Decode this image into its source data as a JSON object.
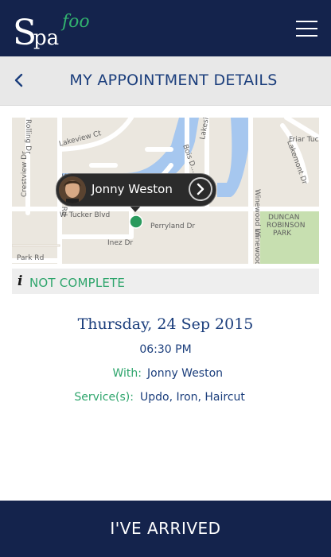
{
  "app": {
    "logo_text": "Spafoo",
    "colors": {
      "nav_bg": "#14234c",
      "title_blue": "#1b3e7c",
      "accent_green": "#2ea56c",
      "title_bar_bg": "#e8e8e8"
    }
  },
  "header": {
    "menu_icon": "hamburger-menu-icon"
  },
  "title_bar": {
    "back_icon": "chevron-left-icon",
    "title": "MY APPOINTMENT DETAILS"
  },
  "map": {
    "street_labels": [
      "Lakeview Ct",
      "Lakeside Dr",
      "Friar Tuck",
      "Lakemont Dr",
      "Crestview Dr",
      "S Bowen Rd",
      "Bois D...",
      "Winewood Ln",
      "W Tucker Blvd",
      "Perryland Dr",
      "Inez Dr",
      "Park Rd",
      "DUNCAN",
      "ROBINSON",
      "PARK",
      "Winewood",
      "Rolling Dr"
    ],
    "marker_icon": "location-pin-icon",
    "callout": {
      "name": "Jonny Weston",
      "avatar_icon": "stylist-avatar",
      "arrow_icon": "chevron-right-circle-icon"
    }
  },
  "status": {
    "icon": "info-icon",
    "text": "NOT COMPLETE"
  },
  "appointment": {
    "date": "Thursday, 24 Sep 2015",
    "time": "06:30 PM",
    "with_label": "With:",
    "with_value": "Jonny Weston",
    "services_label": "Service(s):",
    "services_value": "Updo, Iron, Haircut"
  },
  "cta": {
    "label": "I'VE ARRIVED"
  }
}
